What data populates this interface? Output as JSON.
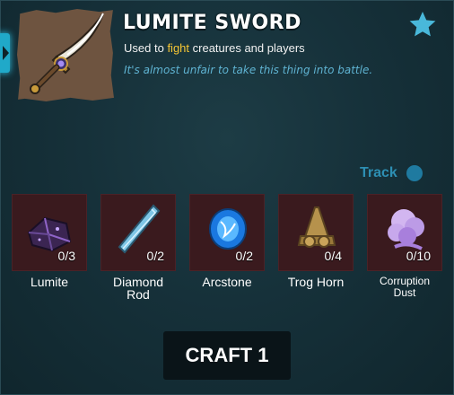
{
  "item": {
    "title": "LUMITE SWORD",
    "usage_prefix": "Used to",
    "usage_highlight": "fight",
    "usage_suffix": "creatures and players",
    "flavor": "It's almost unfair to take this thing into battle.",
    "icon": "lumite-sword-icon"
  },
  "favorite": {
    "icon": "star-icon",
    "color": "#49b8da"
  },
  "track": {
    "label": "Track",
    "color": "#2d8fb3"
  },
  "materials": [
    {
      "name_line1": "Lumite",
      "name_line2": "",
      "count": "0/3",
      "icon": "lumite-ore-icon"
    },
    {
      "name_line1": "Diamond",
      "name_line2": "Rod",
      "count": "0/2",
      "icon": "diamond-rod-icon"
    },
    {
      "name_line1": "Arcstone",
      "name_line2": "",
      "count": "0/2",
      "icon": "arcstone-icon"
    },
    {
      "name_line1": "Trog Horn",
      "name_line2": "",
      "count": "0/4",
      "icon": "trog-horn-icon"
    },
    {
      "name_line1": "Corruption",
      "name_line2": "Dust",
      "count": "0/10",
      "icon": "corruption-dust-icon"
    }
  ],
  "craft": {
    "label": "CRAFT 1"
  },
  "colors": {
    "highlight": "#f5c634",
    "slot_bg": "#3a1a1e",
    "panel_bg": "#16313a"
  }
}
